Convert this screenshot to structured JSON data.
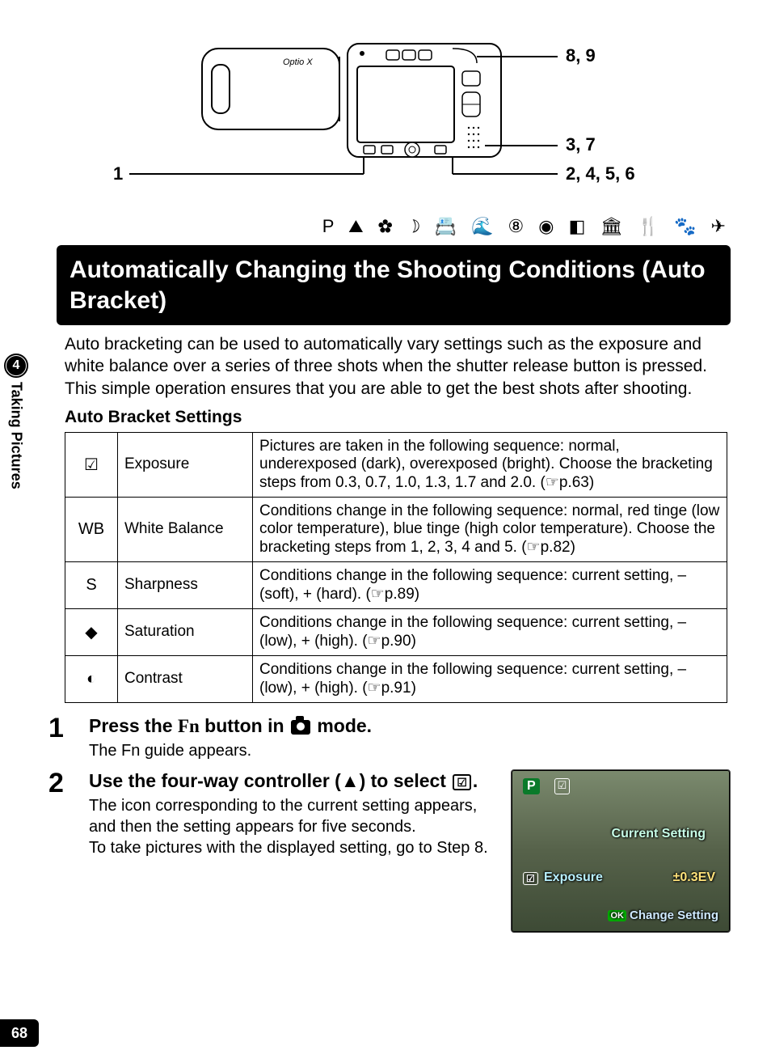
{
  "sidebar": {
    "chapter_number": "4",
    "chapter_title": "Taking Pictures"
  },
  "page_number": "68",
  "diagram": {
    "callouts": {
      "top_right": "8, 9",
      "mid_right": "3, 7",
      "bottom_right": "2, 4, 5, 6",
      "bottom_left": "1"
    },
    "icons_row": "P  ⛰  ✿  ☽  📇  🌊  ⑧  ◉  ◧  🏛  🍴  🐾  ✈"
  },
  "title": "Automatically Changing the Shooting Conditions (Auto Bracket)",
  "intro": "Auto bracketing can be used to automatically vary settings such as the exposure and white balance over a series of three shots when the shutter release button is pressed. This simple operation ensures that you are able to get the best shots after shooting.",
  "table_heading": "Auto Bracket Settings",
  "table": [
    {
      "icon": "☑",
      "name": "Exposure",
      "desc": "Pictures are taken in the following sequence: normal, underexposed (dark), overexposed (bright). Choose the bracketing steps from 0.3, 0.7, 1.0, 1.3, 1.7 and 2.0. (☞p.63)"
    },
    {
      "icon": "WB",
      "name": "White Balance",
      "desc": "Conditions change in the following sequence: normal, red tinge (low color temperature), blue tinge (high color temperature). Choose the bracketing steps from 1, 2, 3, 4 and 5. (☞p.82)"
    },
    {
      "icon": "S",
      "name": "Sharpness",
      "desc": "Conditions change in the following sequence: current setting, – (soft), + (hard). (☞p.89)"
    },
    {
      "icon": "◆",
      "name": "Saturation",
      "desc": "Conditions change in the following sequence: current setting, – (low), + (high). (☞p.90)"
    },
    {
      "icon": "◐",
      "name": "Contrast",
      "desc": "Conditions change in the following sequence: current setting, – (low), + (high). (☞p.91)"
    }
  ],
  "steps": {
    "s1": {
      "num": "1",
      "title_pre": "Press the ",
      "title_fn": "Fn",
      "title_mid": " button in ",
      "title_post": " mode.",
      "desc": "The Fn guide appears."
    },
    "s2": {
      "num": "2",
      "title_pre": "Use the four-way controller (",
      "title_arrow": "▲",
      "title_mid": ") to select ",
      "title_post": ".",
      "desc": "The icon corresponding to the current setting appears, and then the setting appears for five seconds.\nTo take pictures with the displayed setting, go to Step 8."
    }
  },
  "lcd": {
    "p_badge": "P",
    "bracket_badge": "☑",
    "current_setting": "Current Setting",
    "exposure_icon": "☑",
    "exposure_label": "Exposure",
    "exposure_value": "±0.3EV",
    "ok_label": "OK",
    "change_setting": "Change Setting"
  }
}
